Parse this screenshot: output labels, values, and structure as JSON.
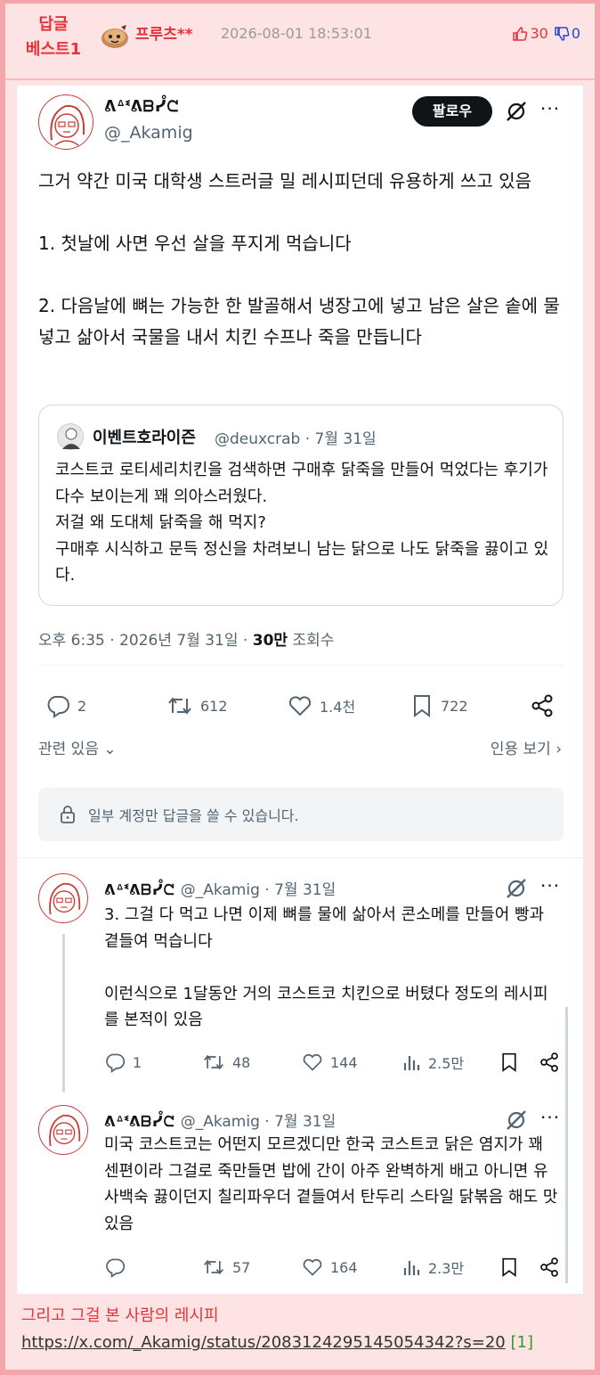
{
  "post": {
    "badge_line1": "답글",
    "badge_line2": "베스트1",
    "author": "프루츠**",
    "datetime": "2026-08-01 18:53:01",
    "upvotes": "30",
    "downvotes": "0"
  },
  "tweet": {
    "display_name": "ᕕᐞᓫᕕᗷᓮᘧ",
    "handle": "@_Akamig",
    "follow_label": "팔로우",
    "text": "그거 약간 미국 대학생 스트러글 밀 레시피던데 유용하게 쓰고 있음\n\n1. 첫날에 사면 우선 살을 푸지게 먹습니다\n\n2. 다음날에 뼈는 가능한 한 발골해서 냉장고에 넣고 남은 살은 솥에 물넣고 삶아서 국물을 내서 치킨 수프나 죽을 만듭니다",
    "timestamp": "오후 6:35 · 2026년 7월 31일 · ",
    "views_count": "30만",
    "views_label": " 조회수",
    "stats": {
      "replies": "2",
      "retweets": "612",
      "likes": "1.4천",
      "bookmarks": "722"
    },
    "related_label": "관련 있음",
    "quotes_label": "인용 보기 ›",
    "restricted_notice": "일부 계정만 답글을 쓸 수 있습니다."
  },
  "quote": {
    "name": "이벤트호라이즌",
    "meta": "@deuxcrab · 7월 31일",
    "text": "코스트코 로티세리치킨을 검색하면 구매후 닭죽을 만들어 먹었다는 후기가 다수 보이는게 꽤 의아스러웠다.\n저걸 왜 도대체 닭죽을 해 먹지?\n구매후 시식하고 문득 정신을 차려보니 남는 닭으로 나도 닭죽을 끓이고 있다."
  },
  "replies": [
    {
      "display_name": "ᕕᐞᓫᕕᗷᓮᘧ",
      "meta": "@_Akamig · 7월 31일",
      "text": "3. 그걸 다 먹고 나면 이제 뼈를 물에 삶아서 콘소메를 만들어 빵과 곁들여 먹습니다\n\n이런식으로 1달동안 거의 코스트코 치킨으로 버텼다 정도의 레시피를 본적이 있음",
      "replies": "1",
      "retweets": "48",
      "likes": "144",
      "views": "2.5만"
    },
    {
      "display_name": "ᕕᐞᓫᕕᗷᓮᘧ",
      "meta": "@_Akamig · 7월 31일",
      "text": "미국 코스트코는 어떤지 모르겠디만 한국 코스트코 닭은 염지가 꽤 센편이라 그걸로 죽만들면 밥에 간이 아주 완벽하게 배고 아니면 유사백숙 끓이던지 칠리파우더 곁들여서 탄두리 스타일 닭볶음 해도 맛있음",
      "replies": "",
      "retweets": "57",
      "likes": "164",
      "views": "2.3만"
    }
  ],
  "footer": {
    "text": "그리고 그걸 본 사람의 레시피 ",
    "link": "https://x.com/_Akamig/status/2083124295145054342?s=20",
    "ref": "[1]"
  },
  "colors": {
    "accent": "#e8323a",
    "down": "#2545d3",
    "muted": "#536471",
    "background": "#f4a6aa"
  }
}
